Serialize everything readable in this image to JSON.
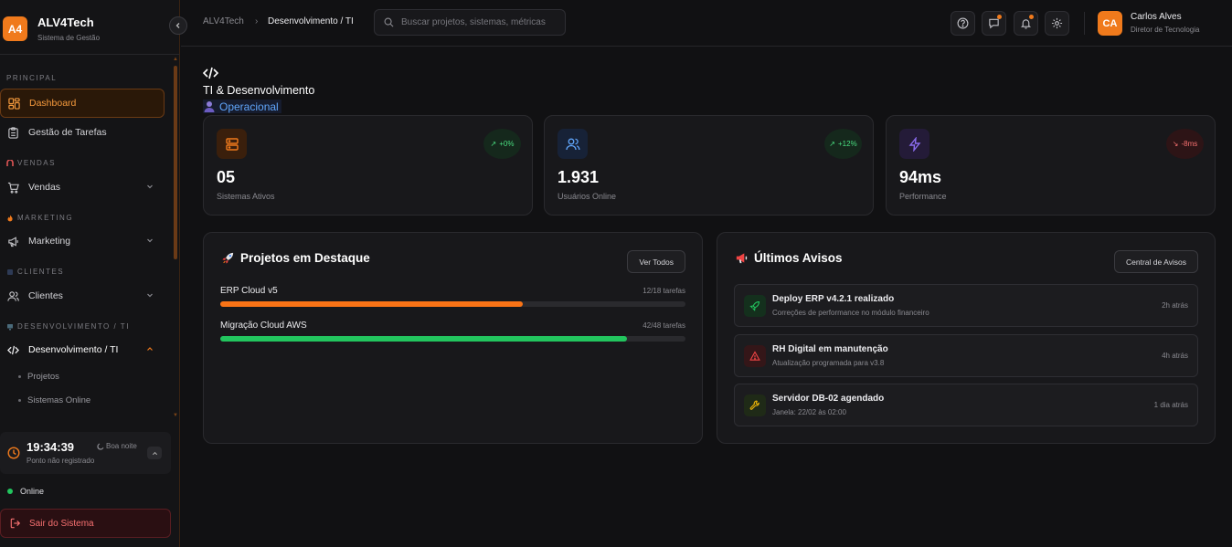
{
  "brand": {
    "logo": "A4",
    "name": "ALV4Tech",
    "subtitle": "Sistema de Gestão"
  },
  "sidebar": {
    "sections": {
      "principal": "PRINCIPAL",
      "vendas": "VENDAS",
      "marketing": "MARKETING",
      "clientes": "CLIENTES",
      "dev": "DESENVOLVIMENTO / TI"
    },
    "items": {
      "dashboard": "Dashboard",
      "tarefas": "Gestão de Tarefas",
      "vendas": "Vendas",
      "marketing": "Marketing",
      "clientes": "Clientes",
      "dev": "Desenvolvimento / TI"
    },
    "subitems": [
      "Projetos",
      "Sistemas Online"
    ],
    "clock": {
      "time": "19:34:39",
      "status": "Ponto não registrado",
      "greeting": "Boa noite"
    },
    "online": "Online",
    "logout": "Sair do Sistema"
  },
  "header": {
    "breadcrumb_root": "ALV4Tech",
    "breadcrumb_sep": "›",
    "breadcrumb_current": "Desenvolvimento / TI",
    "search_placeholder": "Buscar projetos, sistemas, métricas",
    "user": {
      "initials": "CA",
      "name": "Carlos Alves",
      "role": "Diretor de Tecnologia"
    }
  },
  "page": {
    "title": "TI & Desenvolvimento",
    "status": "Operacional"
  },
  "stats": [
    {
      "value": "05",
      "label": "Sistemas Ativos",
      "trend": "+0%",
      "icon": "server-icon"
    },
    {
      "value": "1.931",
      "label": "Usuários Online",
      "trend": "+12%",
      "icon": "users-icon"
    },
    {
      "value": "94ms",
      "label": "Performance",
      "trend": "-8ms",
      "icon": "bolt-icon"
    }
  ],
  "projects": {
    "title": "Projetos em Destaque",
    "button": "Ver Todos",
    "items": [
      {
        "name": "ERP Cloud v5",
        "count": "12/18 tarefas",
        "progress": 0.65,
        "color": "#f97316"
      },
      {
        "name": "Migração Cloud AWS",
        "count": "42/48 tarefas",
        "progress": 0.875,
        "color": "#22c55e"
      }
    ]
  },
  "notices": {
    "title": "Últimos Avisos",
    "button": "Central de Avisos",
    "items": [
      {
        "title": "Deploy ERP v4.2.1 realizado",
        "desc": "Correções de performance no módulo financeiro",
        "time": "2h atrás",
        "icon": "rocket-icon"
      },
      {
        "title": "RH Digital em manutenção",
        "desc": "Atualização programada para v3.8",
        "time": "4h atrás",
        "icon": "warning-icon"
      },
      {
        "title": "Servidor DB-02 agendado",
        "desc": "Janela: 22/02 às 02:00",
        "time": "1 dia atrás",
        "icon": "wrench-icon"
      }
    ]
  },
  "colors": {
    "accent": "#f07a1c",
    "success": "#22c55e",
    "danger": "#ef4444",
    "info": "#60a5fa",
    "bg": "#111113"
  }
}
